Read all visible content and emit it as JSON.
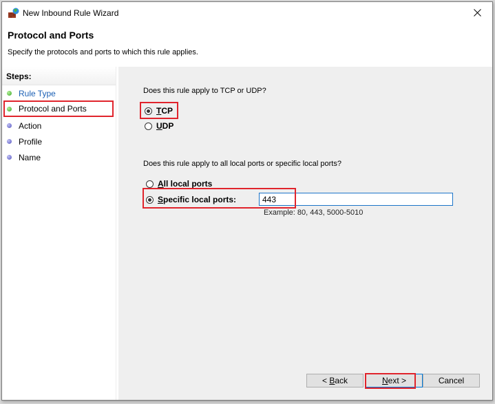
{
  "window": {
    "title": "New Inbound Rule Wizard",
    "icon": "firewall-icon",
    "close_icon": "close-icon"
  },
  "header": {
    "title": "Protocol and Ports",
    "subtitle": "Specify the protocols and ports to which this rule applies."
  },
  "steps": {
    "heading": "Steps:",
    "items": [
      {
        "label": "Rule Type",
        "state": "done",
        "link": true
      },
      {
        "label": "Protocol and Ports",
        "state": "current",
        "link": false
      },
      {
        "label": "Action",
        "state": "todo",
        "link": false
      },
      {
        "label": "Profile",
        "state": "todo",
        "link": false
      },
      {
        "label": "Name",
        "state": "todo",
        "link": false
      }
    ]
  },
  "protocol": {
    "question": "Does this rule apply to TCP or UDP?",
    "options": [
      {
        "label_u": "T",
        "label_rest": "CP",
        "checked": true
      },
      {
        "label_u": "U",
        "label_rest": "DP",
        "checked": false
      }
    ]
  },
  "ports": {
    "question": "Does this rule apply to all local ports or specific local ports?",
    "options": [
      {
        "label_u": "A",
        "label_rest": "ll local ports",
        "checked": false
      },
      {
        "label_u": "S",
        "label_rest": "pecific local ports:",
        "checked": true
      }
    ],
    "value": "443",
    "example": "Example: 80, 443, 5000-5010"
  },
  "buttons": {
    "back": {
      "prefix": "< ",
      "u": "B",
      "rest": "ack"
    },
    "next": {
      "u": "N",
      "rest": "ext >"
    },
    "cancel": "Cancel"
  },
  "colors": {
    "highlight": "#e0232b",
    "focus_border": "#1a73c8",
    "link": "#1a5fb4"
  }
}
